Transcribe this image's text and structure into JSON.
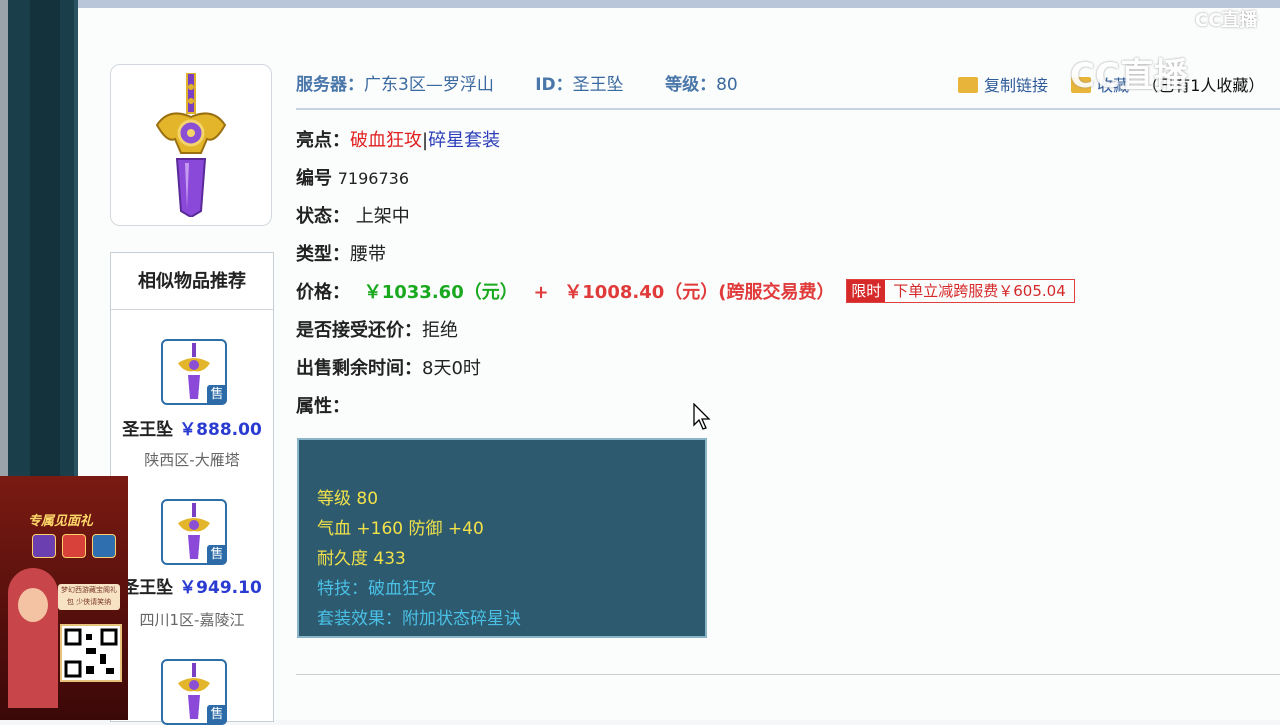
{
  "header": {
    "server_label": "服务器：",
    "server_value": "广东3区—罗浮山",
    "id_label": "ID：",
    "id_value": "圣王坠",
    "level_label": "等级：",
    "level_value": "80"
  },
  "actions": {
    "copy_link": "复制链接",
    "collect": "收藏",
    "collected_count": "（已有1人收藏）"
  },
  "details": {
    "highlight_label": "亮点：",
    "highlight_1": "破血狂攻",
    "highlight_sep": "|",
    "highlight_2": "碎星套装",
    "serial_label": "编号",
    "serial_value": "7196736",
    "status_label": "状态：",
    "status_value": "上架中",
    "type_label": "类型：",
    "type_value": "腰带",
    "price_label": "价格：",
    "price_main": "￥1033.60（元）",
    "price_plus": "+",
    "price_fee": "￥1008.40（元）(跨服交易费）",
    "promo_tag": "限时",
    "promo_text": "下单立减跨服费￥605.04",
    "bargain_label": "是否接受还价：",
    "bargain_value": "拒绝",
    "remaining_label": "出售剩余时间：",
    "remaining_value": "8天0时",
    "attr_label": "属性："
  },
  "attributes": {
    "line1": "等级 80",
    "line2": "气血 +160 防御 +40",
    "line3": "耐久度 433",
    "line4": "特技：破血狂攻",
    "line5": "套装效果：附加状态碎星诀"
  },
  "recommend": {
    "title": "相似物品推荐",
    "badge": "售",
    "items": [
      {
        "name": "圣王坠",
        "price": "￥888.00",
        "server": "陕西区-大雁塔"
      },
      {
        "name": "圣王坠",
        "price": "￥949.10",
        "server": "四川1区-嘉陵江"
      },
      {
        "name": "",
        "price": "",
        "server": ""
      }
    ]
  },
  "watermark": {
    "small": "CC直播",
    "large": "CC直播"
  },
  "ad": {
    "title": "专属见面礼",
    "card_text": "梦幻西游藏宝阁礼包 少侠请笑纳"
  }
}
